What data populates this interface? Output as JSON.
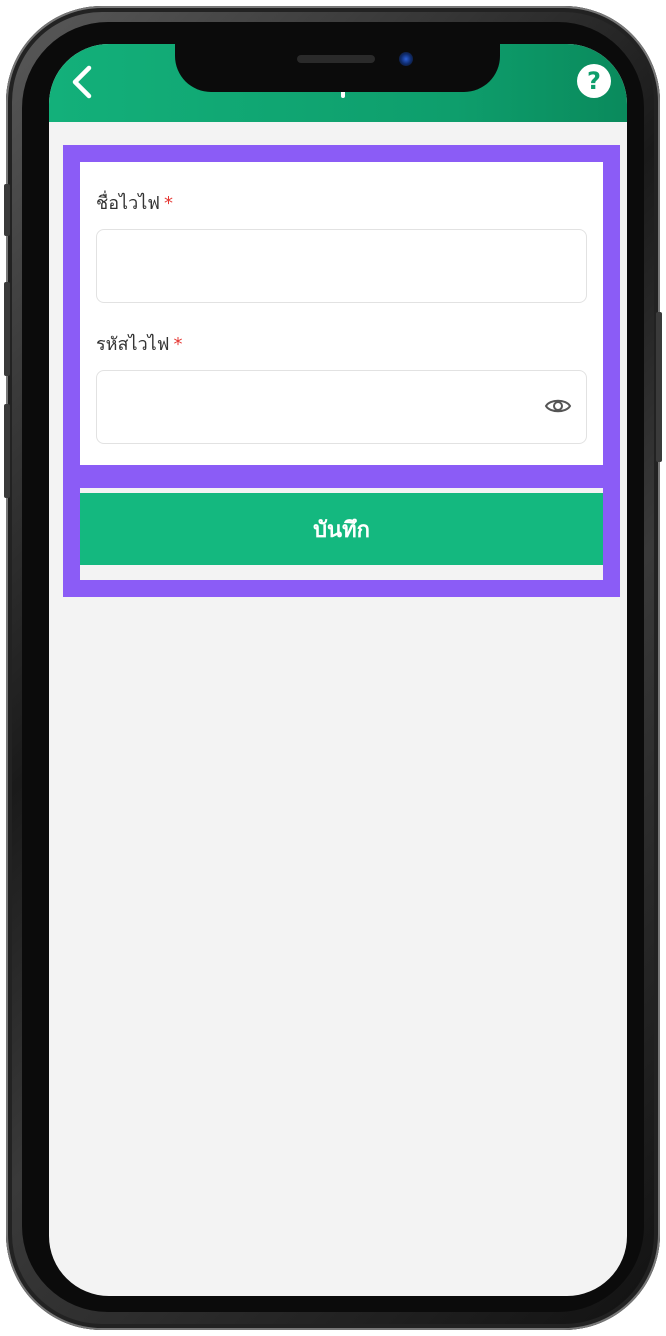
{
  "header": {
    "back_icon": "chevron-left-icon",
    "help_icon": "question-mark-icon",
    "help_symbol": "?",
    "bg_color": "#0e9e6c"
  },
  "form": {
    "wifi_name": {
      "label": "ชื่อไวไฟ",
      "required_mark": "*",
      "value": ""
    },
    "wifi_password": {
      "label": "รหัสไวไฟ",
      "required_mark": "*",
      "value": "",
      "toggle_icon": "eye-icon"
    }
  },
  "actions": {
    "save_label": "บันทึก",
    "save_color": "#14b87f"
  },
  "annotation": {
    "highlight_color": "#8b5cf6"
  }
}
